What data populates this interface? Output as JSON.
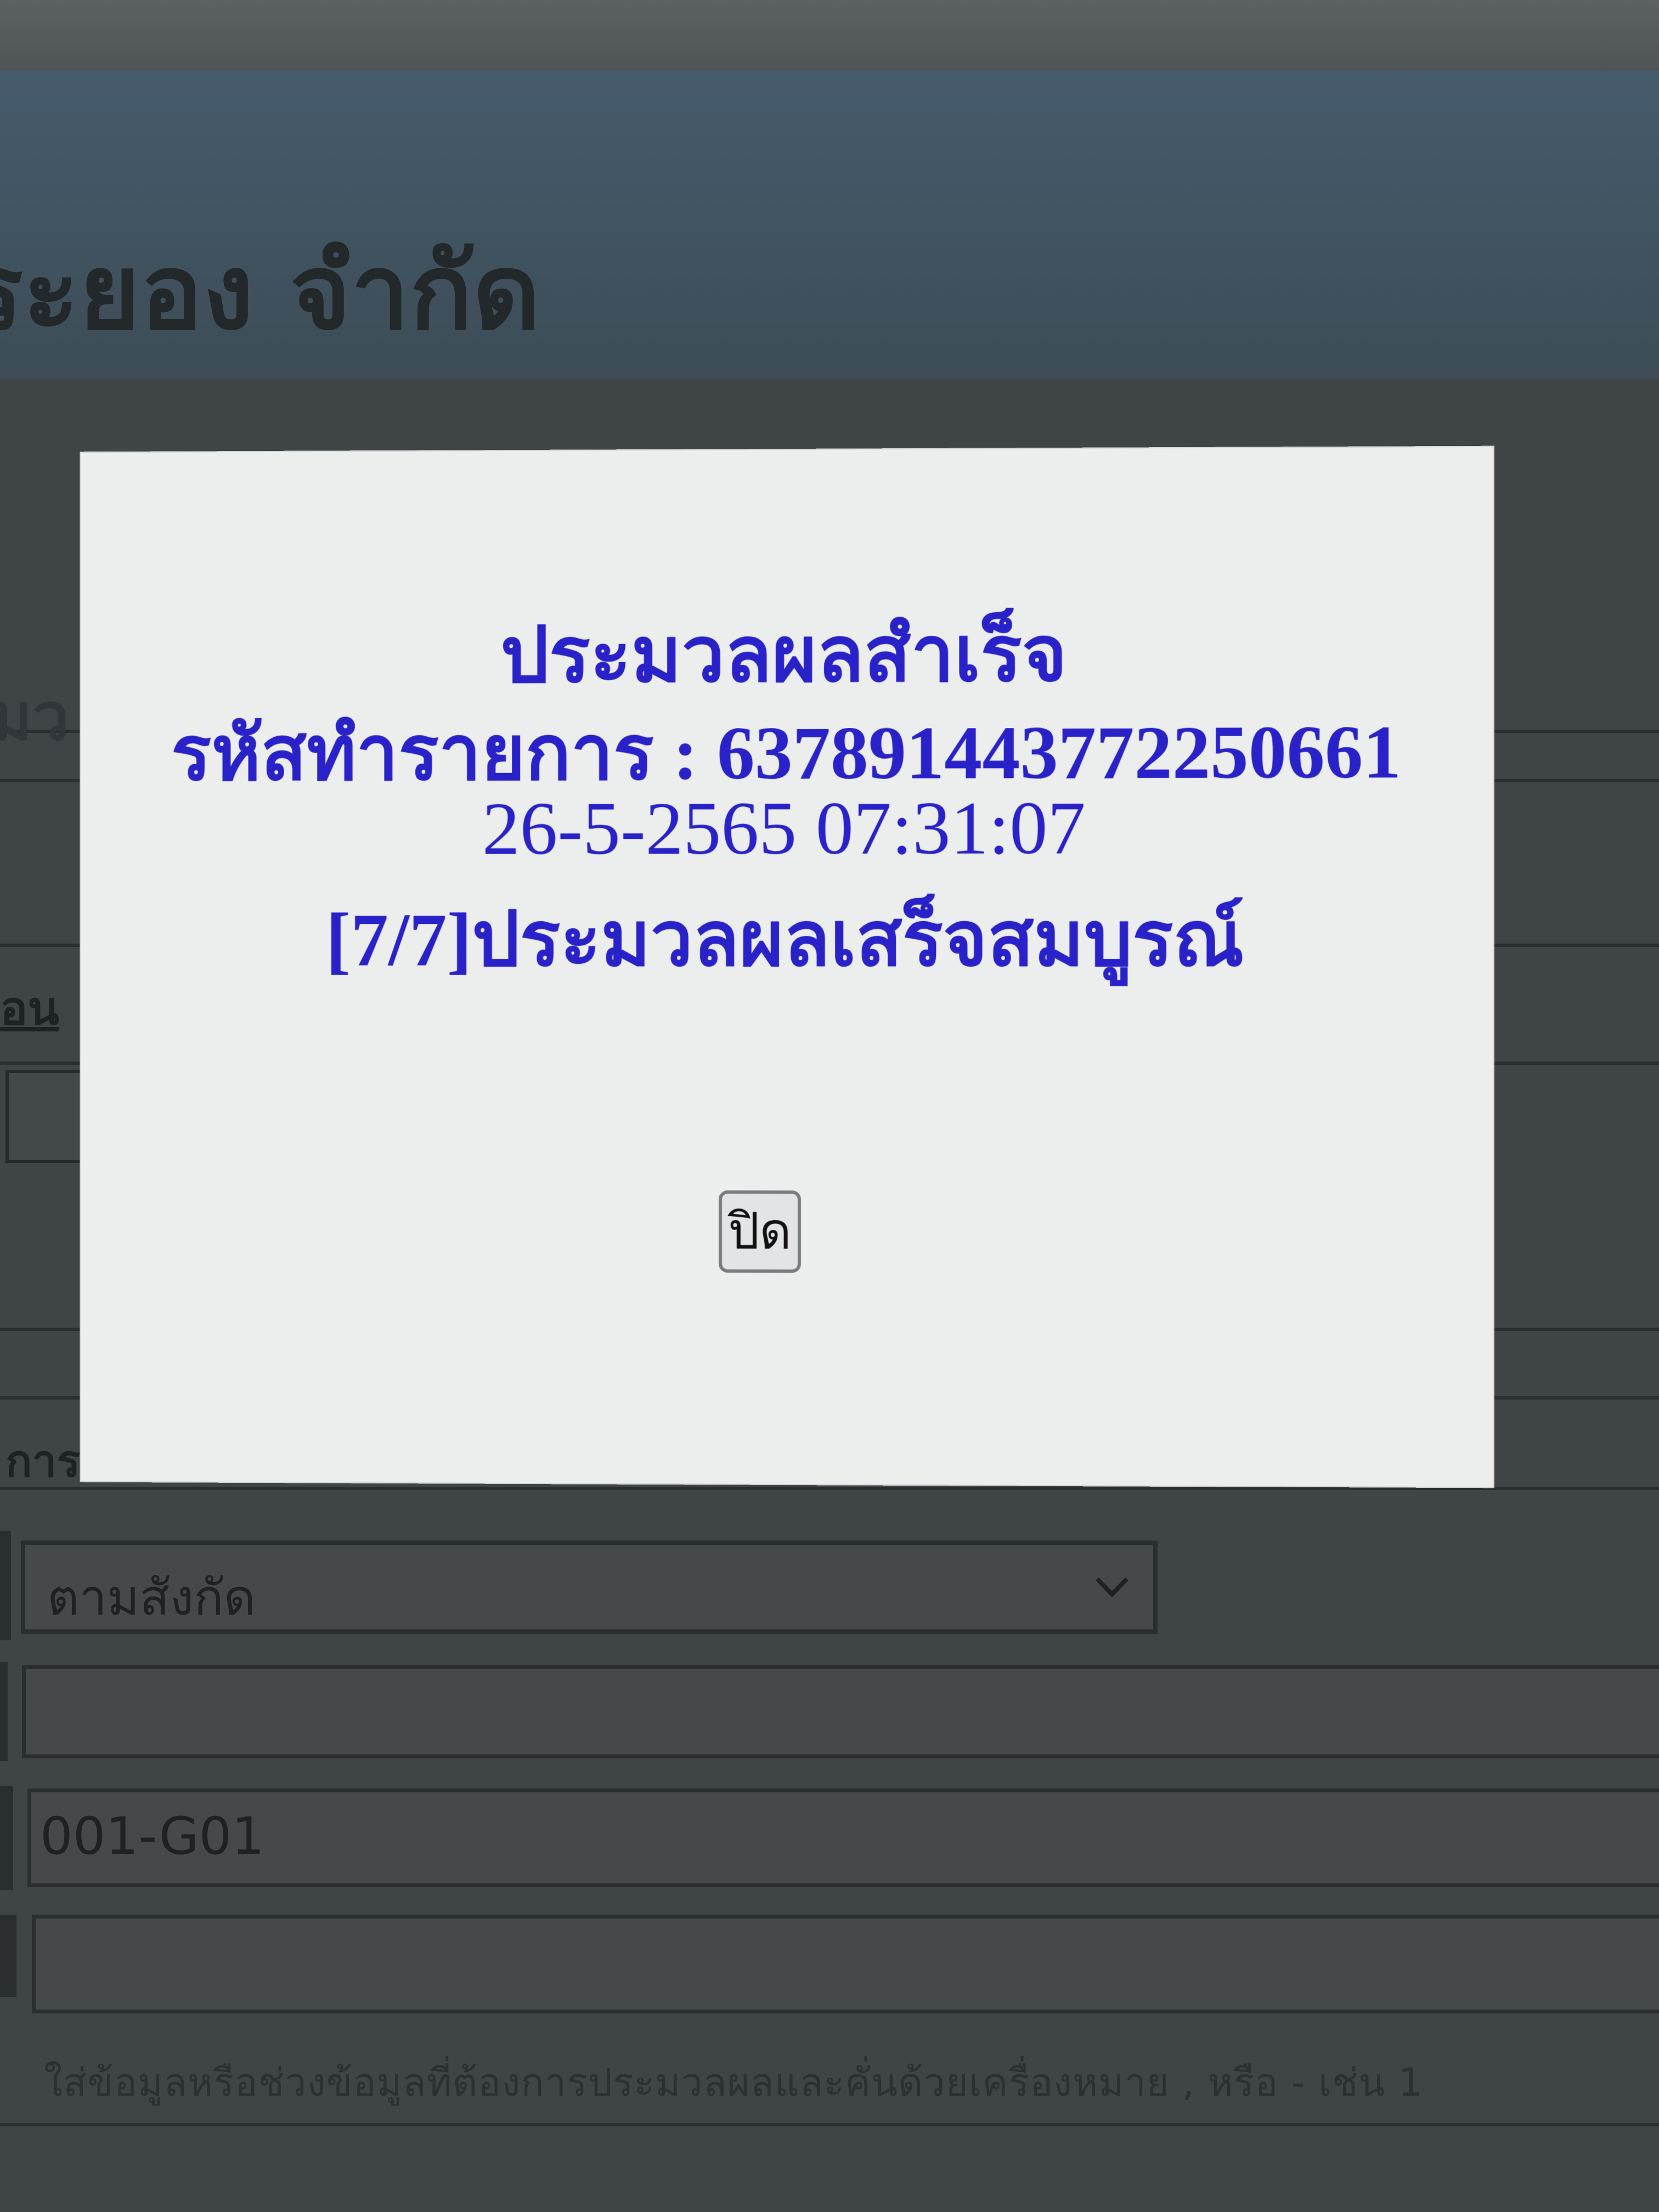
{
  "page": {
    "header_title": "ระยอง จำกัด",
    "side_labels": {
      "label_1": "มว",
      "label_2": "อน",
      "label_3": "การ"
    },
    "dropdown": {
      "selected": "ตามสังกัด"
    },
    "fields": {
      "field_1_value": "",
      "field_2_value": "001-G01",
      "field_3_value": ""
    },
    "hint": "ใส่ข้อมูลหรือช่วงข้อมูลที่ต้องการประมวลผลและคั่นด้วยเครื่องหมาย , หรือ - เช่น 1"
  },
  "modal": {
    "title": "ประมวลผลสำเร็จ",
    "transaction_line": "รหัสทำรายการ : 637891443772250661",
    "datetime": "26-5-2565 07:31:07",
    "status": "[7/7]ประมวลผลเสร็จสมบูรณ์",
    "close_label": "ปิด"
  }
}
